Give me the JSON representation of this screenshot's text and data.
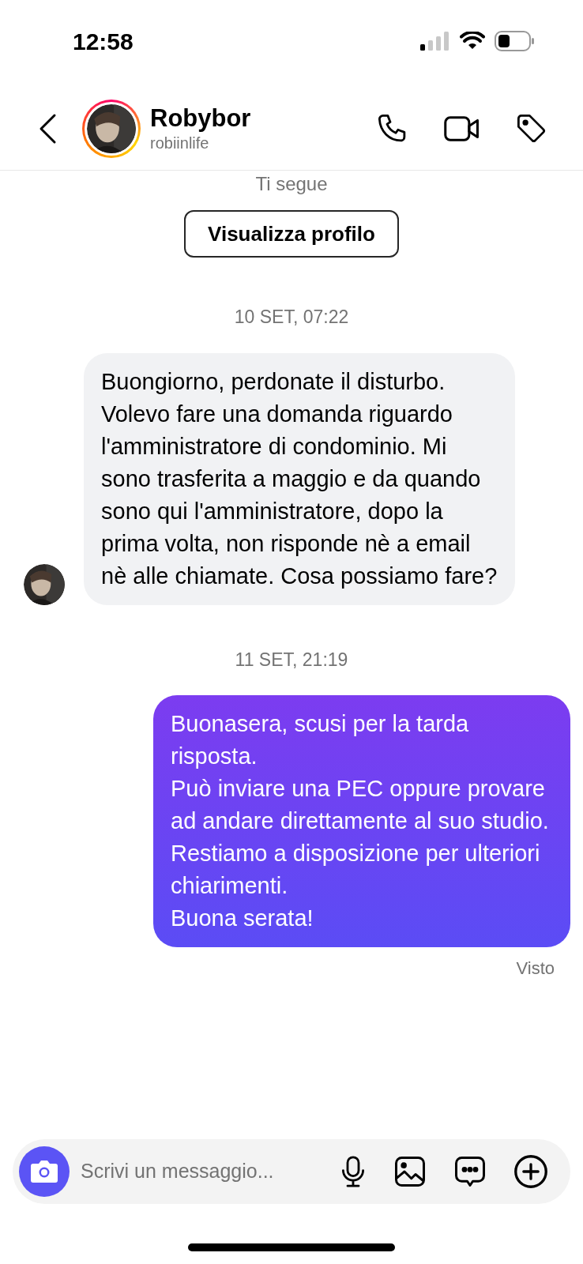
{
  "status_bar": {
    "time": "12:58"
  },
  "header": {
    "name": "Robybor",
    "username": "robiinlife"
  },
  "profile_intro": {
    "follow_note": "Ti segue",
    "button": "Visualizza profilo"
  },
  "messages": [
    {
      "kind": "timestamp",
      "text": "10 SET, 07:22"
    },
    {
      "kind": "received",
      "paragraphs": [
        "Buongiorno, perdonate il disturbo.",
        "Volevo fare una domanda riguardo l'amministratore di condominio. Mi sono trasferita a maggio e da quando sono qui l'amministratore, dopo la prima volta, non risponde nè a email nè alle chiamate. Cosa possiamo fare?"
      ]
    },
    {
      "kind": "timestamp",
      "text": "11 SET, 21:19"
    },
    {
      "kind": "sent",
      "paragraphs": [
        "Buonasera, scusi per la tarda risposta.",
        "Può inviare una PEC oppure provare ad andare direttamente al suo studio.",
        "Restiamo a disposizione per ulteriori chiarimenti.",
        "Buona serata!"
      ]
    },
    {
      "kind": "receipt",
      "text": "Visto"
    }
  ],
  "composer": {
    "placeholder": "Scrivi un messaggio..."
  }
}
